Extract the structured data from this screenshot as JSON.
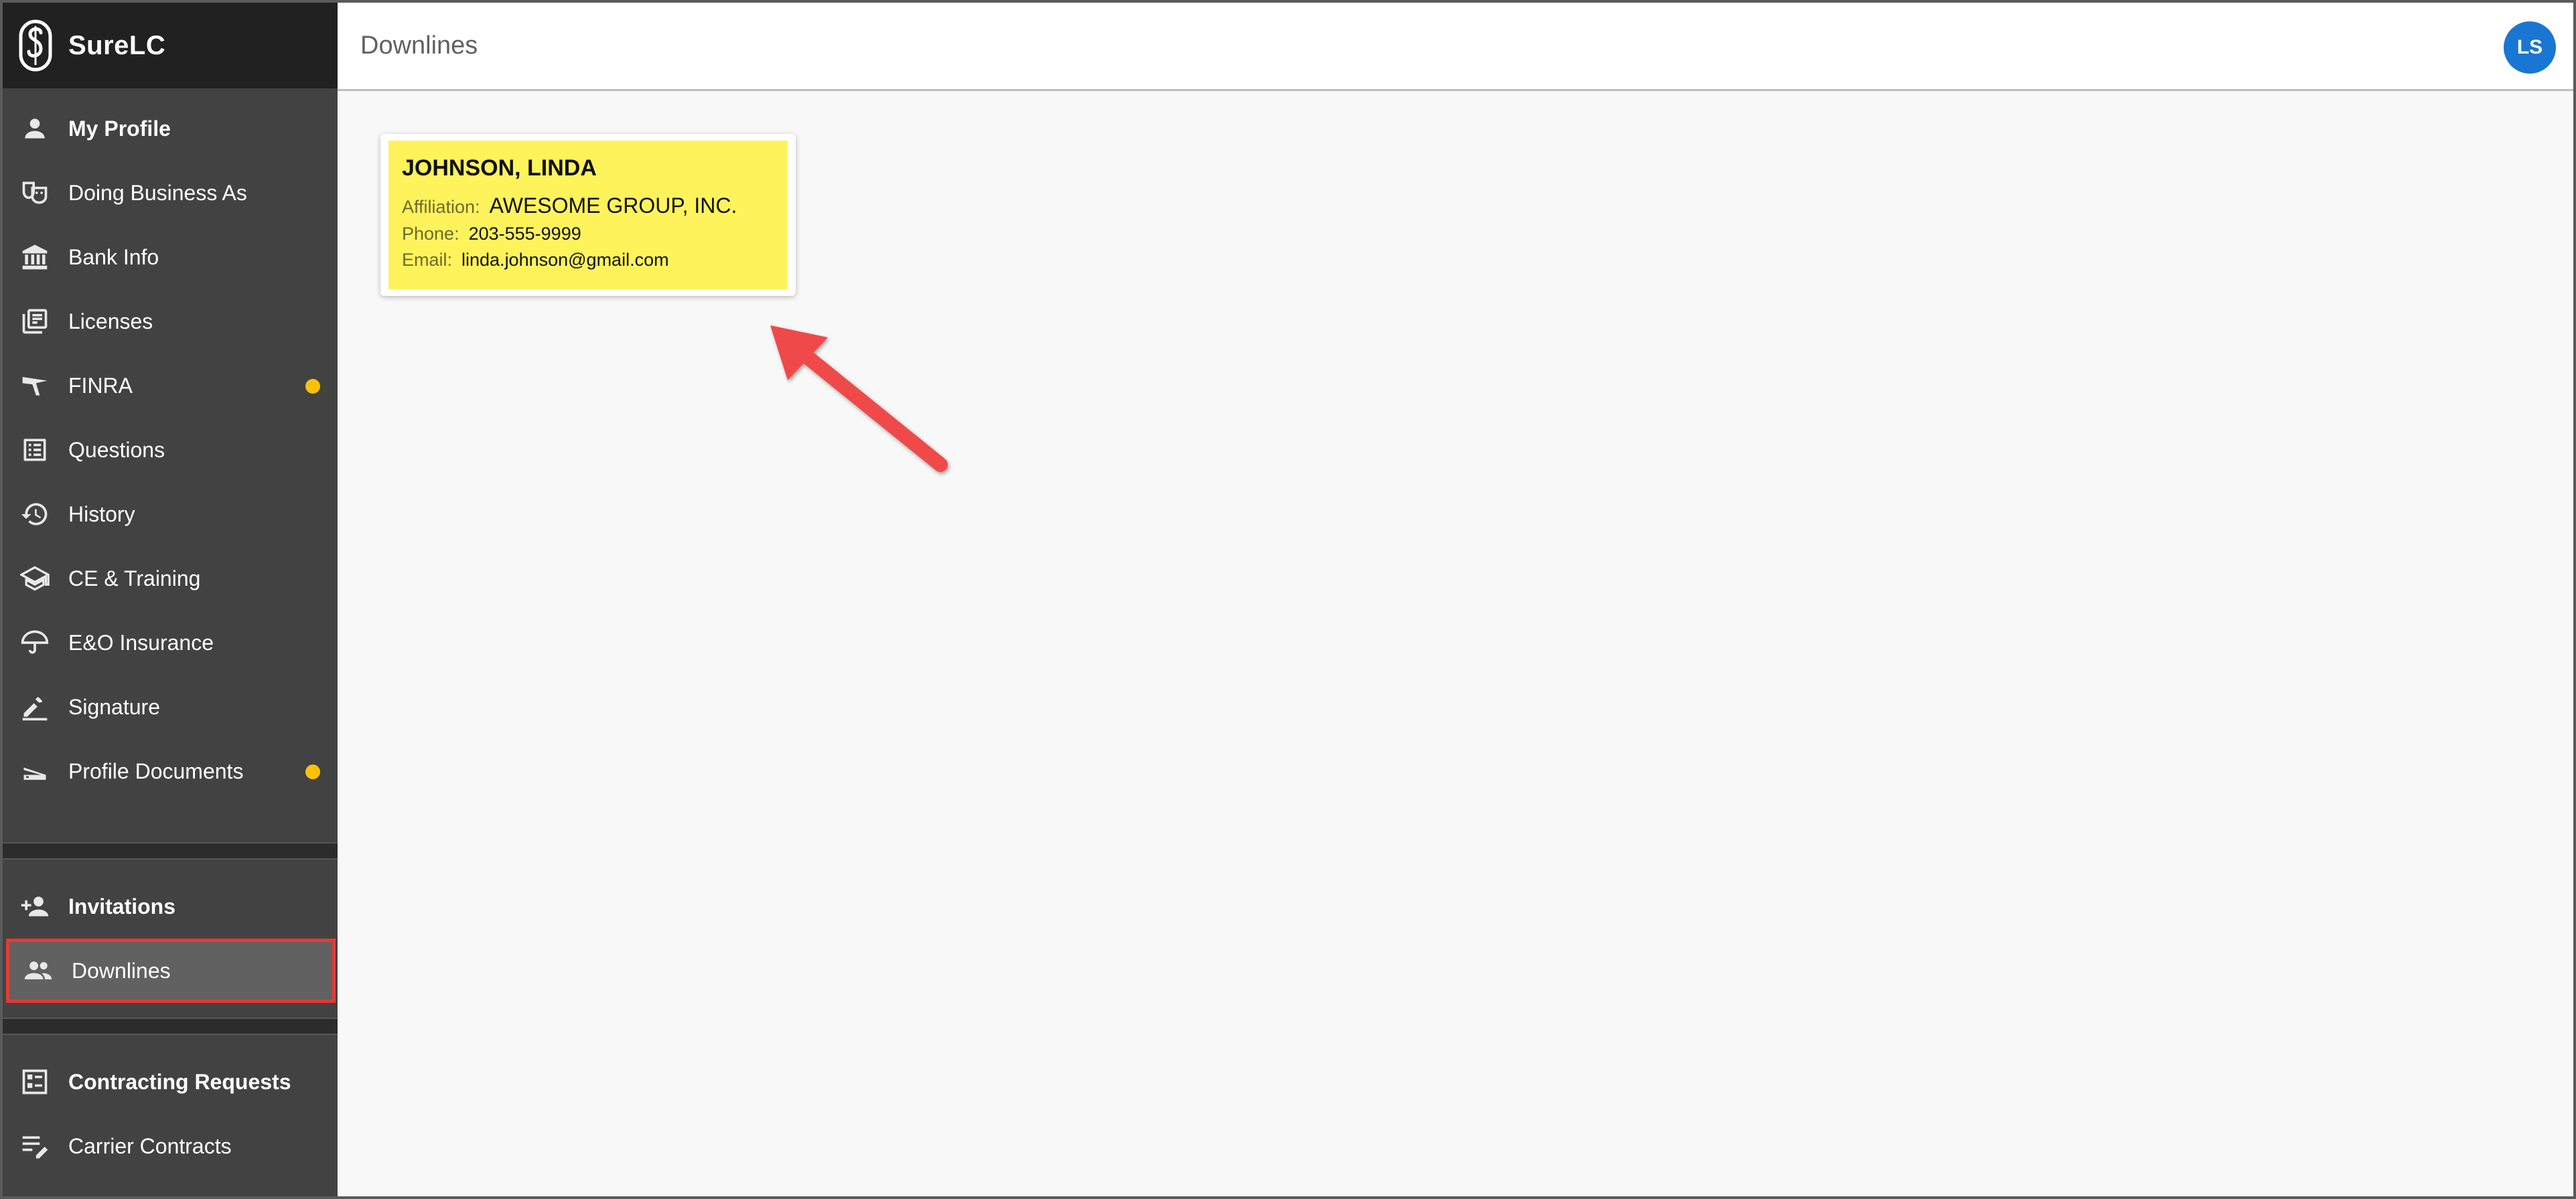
{
  "app": {
    "name": "SureLC"
  },
  "sidebar": {
    "items": [
      {
        "label": "My Profile",
        "icon": "person-icon",
        "bold": true
      },
      {
        "label": "Doing Business As",
        "icon": "mask-icon"
      },
      {
        "label": "Bank Info",
        "icon": "bank-icon"
      },
      {
        "label": "Licenses",
        "icon": "library-books-icon"
      },
      {
        "label": "FINRA",
        "icon": "finra-icon",
        "alert": true
      },
      {
        "label": "Questions",
        "icon": "list-alt-icon"
      },
      {
        "label": "History",
        "icon": "history-icon"
      },
      {
        "label": "CE & Training",
        "icon": "school-icon"
      },
      {
        "label": "E&O Insurance",
        "icon": "umbrella-icon"
      },
      {
        "label": "Signature",
        "icon": "pen-icon"
      },
      {
        "label": "Profile Documents",
        "icon": "scanner-icon",
        "alert": true
      }
    ],
    "group2": [
      {
        "label": "Invitations",
        "icon": "person-add-icon",
        "bold": true
      },
      {
        "label": "Downlines",
        "icon": "people-icon",
        "active": true
      }
    ],
    "group3": [
      {
        "label": "Contracting Requests",
        "icon": "assignment-icon",
        "bold": true
      },
      {
        "label": "Carrier Contracts",
        "icon": "edit-note-icon"
      }
    ],
    "alert_color": "#ffc107"
  },
  "header": {
    "title": "Downlines",
    "avatar_initials": "LS",
    "avatar_color": "#1976d2"
  },
  "card": {
    "name": "JOHNSON, LINDA",
    "affiliation_label": "Affiliation:",
    "affiliation": "AWESOME GROUP, INC.",
    "phone_label": "Phone:",
    "phone": "203-555-9999",
    "email_label": "Email:",
    "email": "linda.johnson@gmail.com",
    "highlight_color": "#fff35c"
  },
  "annotation": {
    "arrow_color": "#f04a4a"
  }
}
